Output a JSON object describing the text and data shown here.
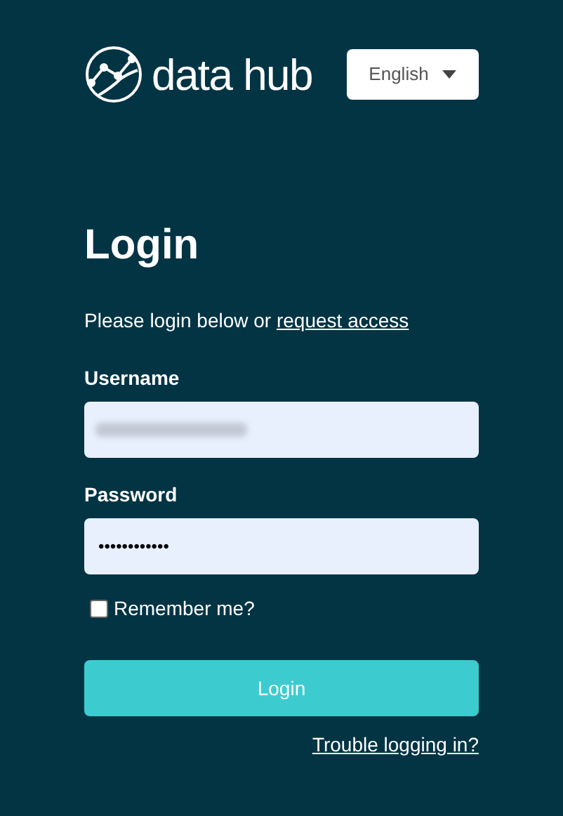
{
  "logo": {
    "text": "data hub"
  },
  "language": {
    "value": "English"
  },
  "title": "Login",
  "intro": {
    "text": "Please login below or ",
    "link": "request access"
  },
  "username": {
    "label": "Username",
    "blurred": true
  },
  "password": {
    "label": "Password",
    "value": "••••••••••••"
  },
  "remember": {
    "label": "Remember me?",
    "checked": false
  },
  "login_button": "Login",
  "trouble_link": "Trouble logging in?"
}
